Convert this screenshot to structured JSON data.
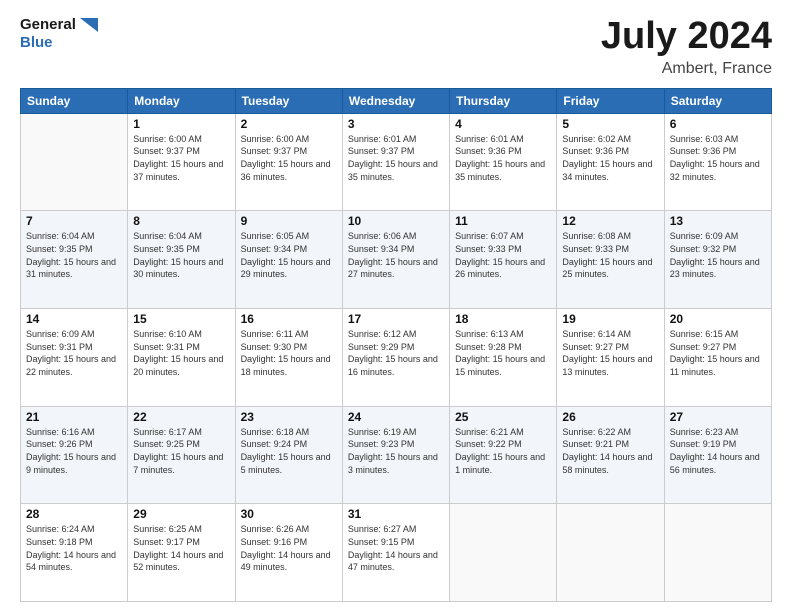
{
  "header": {
    "logo_line1": "General",
    "logo_line2": "Blue",
    "title": "July 2024",
    "subtitle": "Ambert, France"
  },
  "days_of_week": [
    "Sunday",
    "Monday",
    "Tuesday",
    "Wednesday",
    "Thursday",
    "Friday",
    "Saturday"
  ],
  "weeks": [
    [
      {
        "day": "",
        "sunrise": "",
        "sunset": "",
        "daylight": ""
      },
      {
        "day": "1",
        "sunrise": "Sunrise: 6:00 AM",
        "sunset": "Sunset: 9:37 PM",
        "daylight": "Daylight: 15 hours and 37 minutes."
      },
      {
        "day": "2",
        "sunrise": "Sunrise: 6:00 AM",
        "sunset": "Sunset: 9:37 PM",
        "daylight": "Daylight: 15 hours and 36 minutes."
      },
      {
        "day": "3",
        "sunrise": "Sunrise: 6:01 AM",
        "sunset": "Sunset: 9:37 PM",
        "daylight": "Daylight: 15 hours and 35 minutes."
      },
      {
        "day": "4",
        "sunrise": "Sunrise: 6:01 AM",
        "sunset": "Sunset: 9:36 PM",
        "daylight": "Daylight: 15 hours and 35 minutes."
      },
      {
        "day": "5",
        "sunrise": "Sunrise: 6:02 AM",
        "sunset": "Sunset: 9:36 PM",
        "daylight": "Daylight: 15 hours and 34 minutes."
      },
      {
        "day": "6",
        "sunrise": "Sunrise: 6:03 AM",
        "sunset": "Sunset: 9:36 PM",
        "daylight": "Daylight: 15 hours and 32 minutes."
      }
    ],
    [
      {
        "day": "7",
        "sunrise": "Sunrise: 6:04 AM",
        "sunset": "Sunset: 9:35 PM",
        "daylight": "Daylight: 15 hours and 31 minutes."
      },
      {
        "day": "8",
        "sunrise": "Sunrise: 6:04 AM",
        "sunset": "Sunset: 9:35 PM",
        "daylight": "Daylight: 15 hours and 30 minutes."
      },
      {
        "day": "9",
        "sunrise": "Sunrise: 6:05 AM",
        "sunset": "Sunset: 9:34 PM",
        "daylight": "Daylight: 15 hours and 29 minutes."
      },
      {
        "day": "10",
        "sunrise": "Sunrise: 6:06 AM",
        "sunset": "Sunset: 9:34 PM",
        "daylight": "Daylight: 15 hours and 27 minutes."
      },
      {
        "day": "11",
        "sunrise": "Sunrise: 6:07 AM",
        "sunset": "Sunset: 9:33 PM",
        "daylight": "Daylight: 15 hours and 26 minutes."
      },
      {
        "day": "12",
        "sunrise": "Sunrise: 6:08 AM",
        "sunset": "Sunset: 9:33 PM",
        "daylight": "Daylight: 15 hours and 25 minutes."
      },
      {
        "day": "13",
        "sunrise": "Sunrise: 6:09 AM",
        "sunset": "Sunset: 9:32 PM",
        "daylight": "Daylight: 15 hours and 23 minutes."
      }
    ],
    [
      {
        "day": "14",
        "sunrise": "Sunrise: 6:09 AM",
        "sunset": "Sunset: 9:31 PM",
        "daylight": "Daylight: 15 hours and 22 minutes."
      },
      {
        "day": "15",
        "sunrise": "Sunrise: 6:10 AM",
        "sunset": "Sunset: 9:31 PM",
        "daylight": "Daylight: 15 hours and 20 minutes."
      },
      {
        "day": "16",
        "sunrise": "Sunrise: 6:11 AM",
        "sunset": "Sunset: 9:30 PM",
        "daylight": "Daylight: 15 hours and 18 minutes."
      },
      {
        "day": "17",
        "sunrise": "Sunrise: 6:12 AM",
        "sunset": "Sunset: 9:29 PM",
        "daylight": "Daylight: 15 hours and 16 minutes."
      },
      {
        "day": "18",
        "sunrise": "Sunrise: 6:13 AM",
        "sunset": "Sunset: 9:28 PM",
        "daylight": "Daylight: 15 hours and 15 minutes."
      },
      {
        "day": "19",
        "sunrise": "Sunrise: 6:14 AM",
        "sunset": "Sunset: 9:27 PM",
        "daylight": "Daylight: 15 hours and 13 minutes."
      },
      {
        "day": "20",
        "sunrise": "Sunrise: 6:15 AM",
        "sunset": "Sunset: 9:27 PM",
        "daylight": "Daylight: 15 hours and 11 minutes."
      }
    ],
    [
      {
        "day": "21",
        "sunrise": "Sunrise: 6:16 AM",
        "sunset": "Sunset: 9:26 PM",
        "daylight": "Daylight: 15 hours and 9 minutes."
      },
      {
        "day": "22",
        "sunrise": "Sunrise: 6:17 AM",
        "sunset": "Sunset: 9:25 PM",
        "daylight": "Daylight: 15 hours and 7 minutes."
      },
      {
        "day": "23",
        "sunrise": "Sunrise: 6:18 AM",
        "sunset": "Sunset: 9:24 PM",
        "daylight": "Daylight: 15 hours and 5 minutes."
      },
      {
        "day": "24",
        "sunrise": "Sunrise: 6:19 AM",
        "sunset": "Sunset: 9:23 PM",
        "daylight": "Daylight: 15 hours and 3 minutes."
      },
      {
        "day": "25",
        "sunrise": "Sunrise: 6:21 AM",
        "sunset": "Sunset: 9:22 PM",
        "daylight": "Daylight: 15 hours and 1 minute."
      },
      {
        "day": "26",
        "sunrise": "Sunrise: 6:22 AM",
        "sunset": "Sunset: 9:21 PM",
        "daylight": "Daylight: 14 hours and 58 minutes."
      },
      {
        "day": "27",
        "sunrise": "Sunrise: 6:23 AM",
        "sunset": "Sunset: 9:19 PM",
        "daylight": "Daylight: 14 hours and 56 minutes."
      }
    ],
    [
      {
        "day": "28",
        "sunrise": "Sunrise: 6:24 AM",
        "sunset": "Sunset: 9:18 PM",
        "daylight": "Daylight: 14 hours and 54 minutes."
      },
      {
        "day": "29",
        "sunrise": "Sunrise: 6:25 AM",
        "sunset": "Sunset: 9:17 PM",
        "daylight": "Daylight: 14 hours and 52 minutes."
      },
      {
        "day": "30",
        "sunrise": "Sunrise: 6:26 AM",
        "sunset": "Sunset: 9:16 PM",
        "daylight": "Daylight: 14 hours and 49 minutes."
      },
      {
        "day": "31",
        "sunrise": "Sunrise: 6:27 AM",
        "sunset": "Sunset: 9:15 PM",
        "daylight": "Daylight: 14 hours and 47 minutes."
      },
      {
        "day": "",
        "sunrise": "",
        "sunset": "",
        "daylight": ""
      },
      {
        "day": "",
        "sunrise": "",
        "sunset": "",
        "daylight": ""
      },
      {
        "day": "",
        "sunrise": "",
        "sunset": "",
        "daylight": ""
      }
    ]
  ]
}
